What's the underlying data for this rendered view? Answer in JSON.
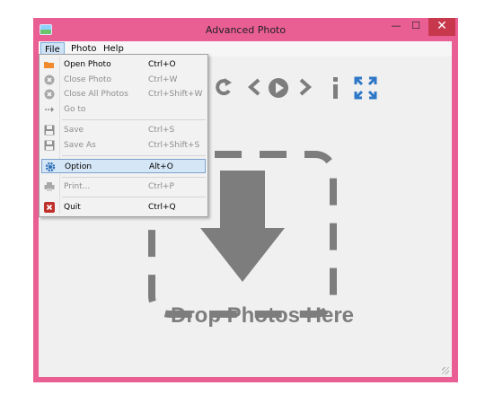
{
  "window": {
    "title": "Advanced Photo",
    "controls": {
      "minimize": "—",
      "maximize": "☐",
      "close": "✕"
    }
  },
  "menubar": {
    "items": [
      "File",
      "Photo",
      "Help"
    ],
    "active": "File"
  },
  "file_menu": {
    "items": [
      {
        "label": "Open Photo",
        "shortcut": "Ctrl+O",
        "icon": "folder-icon",
        "enabled": true
      },
      {
        "label": "Close Photo",
        "shortcut": "Ctrl+W",
        "icon": "close-circle-icon",
        "enabled": false
      },
      {
        "label": "Close All Photos",
        "shortcut": "Ctrl+Shift+W",
        "icon": "close-circle-icon",
        "enabled": false
      },
      {
        "label": "Go to",
        "shortcut": "",
        "icon": "goto-arrow-icon",
        "enabled": false
      },
      {
        "label": "Save",
        "shortcut": "Ctrl+S",
        "icon": "save-icon",
        "enabled": false
      },
      {
        "label": "Save As",
        "shortcut": "Ctrl+Shift+S",
        "icon": "save-as-icon",
        "enabled": false
      },
      {
        "label": "Option",
        "shortcut": "Alt+O",
        "icon": "gear-icon",
        "enabled": true,
        "highlighted": true
      },
      {
        "label": "Print...",
        "shortcut": "Ctrl+P",
        "icon": "printer-icon",
        "enabled": false
      },
      {
        "label": "Quit",
        "shortcut": "Ctrl+Q",
        "icon": "quit-icon",
        "enabled": true
      }
    ]
  },
  "toolbar": {
    "icons": [
      "rotate-icon",
      "previous-icon",
      "play-icon",
      "next-icon",
      "info-icon",
      "fullscreen-icon"
    ]
  },
  "main": {
    "drop_text": "Drop Photos Here"
  },
  "colors": {
    "window_frame": "#e95e93",
    "close_button": "#c7384d",
    "icon_gray": "#7d7d7d",
    "highlight": "#d5e6f7"
  }
}
